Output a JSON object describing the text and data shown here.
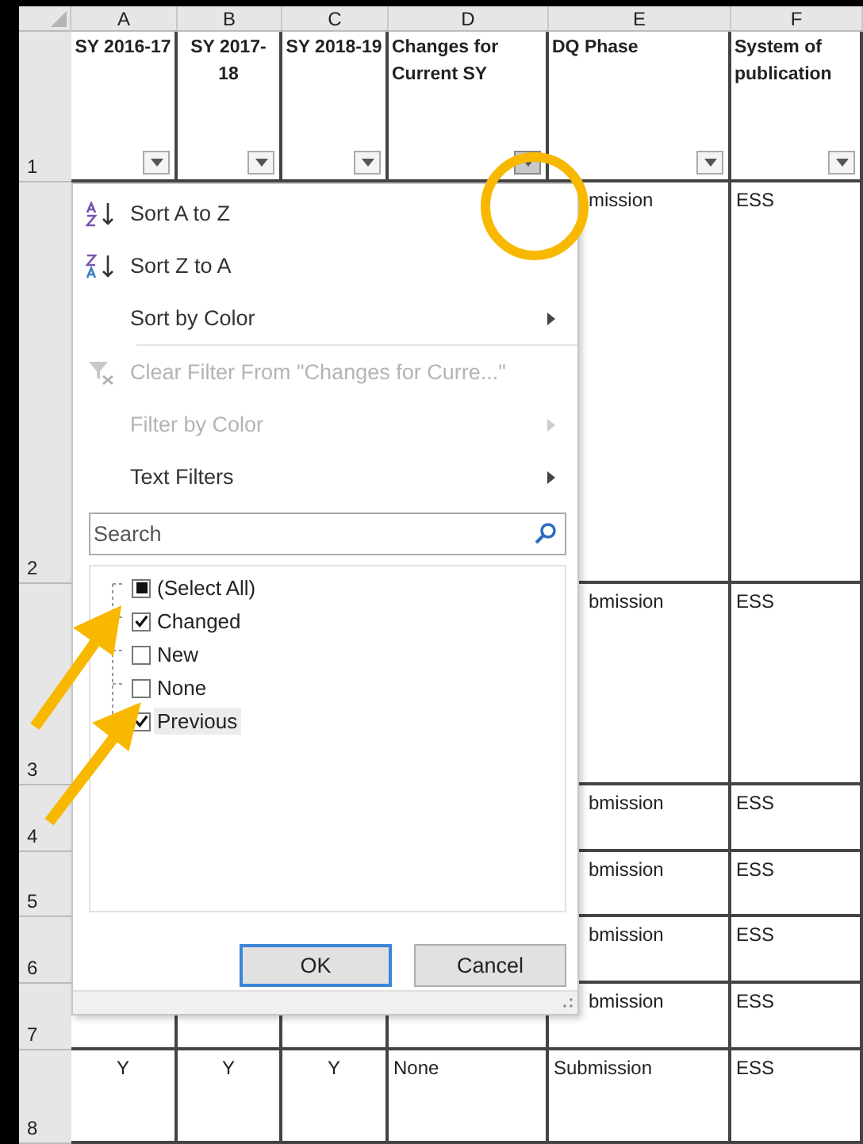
{
  "columns": [
    {
      "letter": "A",
      "heading": "SY 2016-17",
      "filter_open": false
    },
    {
      "letter": "B",
      "heading": "SY 2017-18",
      "filter_open": false
    },
    {
      "letter": "C",
      "heading": "SY 2018-19",
      "filter_open": false
    },
    {
      "letter": "D",
      "heading": "Changes for Current SY",
      "filter_open": true
    },
    {
      "letter": "E",
      "heading": "DQ Phase",
      "filter_open": false
    },
    {
      "letter": "F",
      "heading": "System of publication",
      "filter_open": false
    }
  ],
  "header_row_number": "1",
  "rows": [
    {
      "number": "2",
      "E": "mission",
      "F": "ESS"
    },
    {
      "number": "3",
      "E": "bmission",
      "F": "ESS"
    },
    {
      "number": "4",
      "E": "bmission",
      "F": "ESS"
    },
    {
      "number": "5",
      "E": "bmission",
      "F": "ESS"
    },
    {
      "number": "6",
      "E": "bmission",
      "F": "ESS"
    },
    {
      "number": "7",
      "E": "bmission",
      "F": "ESS"
    },
    {
      "number": "8",
      "A": "Y",
      "B": "Y",
      "C": "Y",
      "D": "None",
      "E": "Submission",
      "F": "ESS"
    }
  ],
  "filter_menu": {
    "items": [
      {
        "kind": "sort-asc",
        "label": "Sort A to Z",
        "disabled": false,
        "submenu": false
      },
      {
        "kind": "sort-desc",
        "label": "Sort Z to A",
        "disabled": false,
        "submenu": false
      },
      {
        "kind": "plain",
        "label": "Sort by Color",
        "disabled": false,
        "submenu": true
      },
      {
        "kind": "clear",
        "label": "Clear Filter From \"Changes for Curre...\"",
        "disabled": true,
        "submenu": false
      },
      {
        "kind": "plain",
        "label": "Filter by Color",
        "disabled": true,
        "submenu": true
      },
      {
        "kind": "plain",
        "label": "Text Filters",
        "disabled": false,
        "submenu": true
      }
    ],
    "search": {
      "placeholder": "Search"
    },
    "values": [
      {
        "label": "(Select All)",
        "indeterminate": true,
        "selected": false
      },
      {
        "label": "Changed",
        "checked": true,
        "selected": false
      },
      {
        "label": "New",
        "checked": false,
        "selected": false
      },
      {
        "label": "None",
        "checked": false,
        "selected": false
      },
      {
        "label": "Previous",
        "checked": true,
        "selected": true
      }
    ],
    "buttons": [
      {
        "label": "OK",
        "default": true
      },
      {
        "label": "Cancel",
        "default": false
      }
    ]
  }
}
